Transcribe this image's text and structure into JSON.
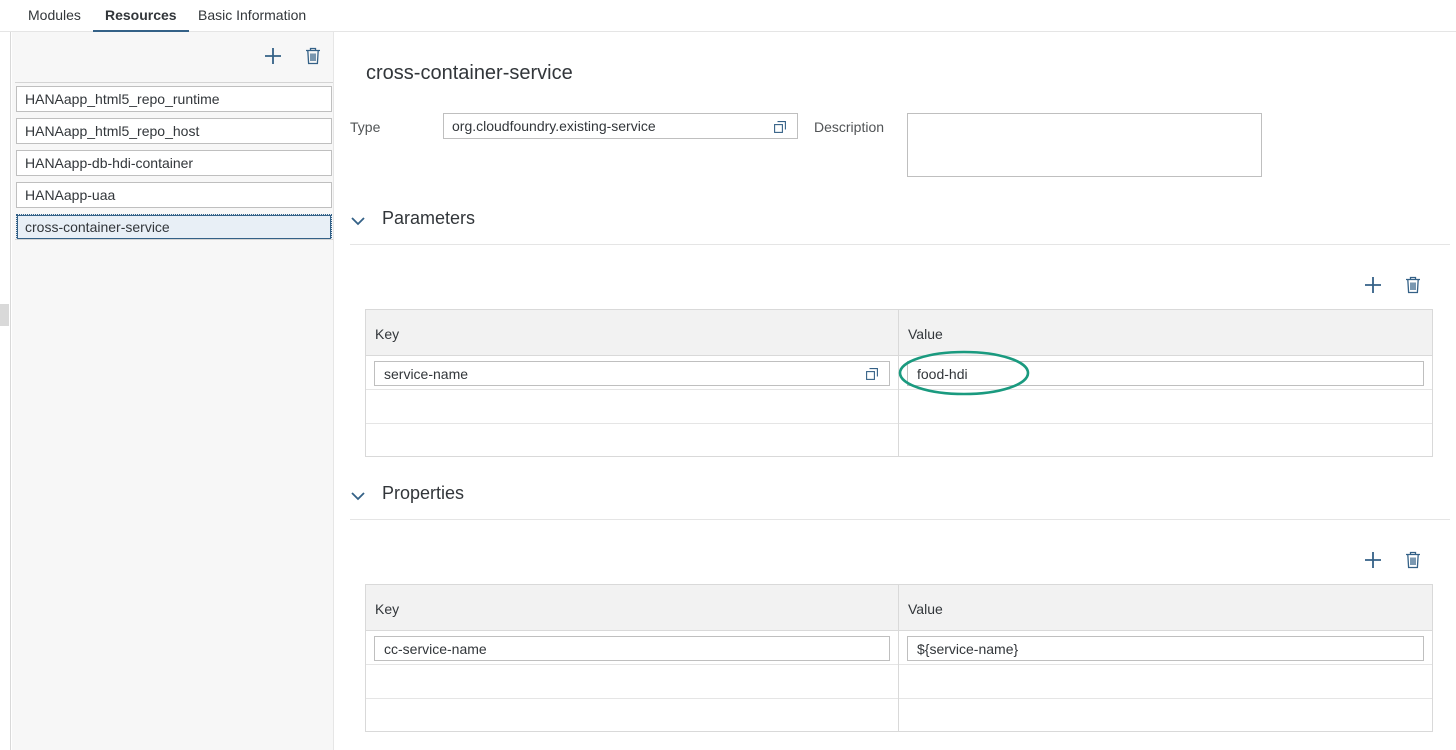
{
  "tabs": [
    {
      "label": "Modules",
      "active": false
    },
    {
      "label": "Resources",
      "active": true
    },
    {
      "label": "Basic Information",
      "active": false
    }
  ],
  "resources": {
    "items": [
      {
        "label": "HANAapp_html5_repo_runtime",
        "selected": false
      },
      {
        "label": "HANAapp_html5_repo_host",
        "selected": false
      },
      {
        "label": "HANAapp-db-hdi-container",
        "selected": false
      },
      {
        "label": "HANAapp-uaa",
        "selected": false
      },
      {
        "label": "cross-container-service",
        "selected": true
      }
    ]
  },
  "detail": {
    "title": "cross-container-service",
    "type_label": "Type",
    "type_value": "org.cloudfoundry.existing-service",
    "description_label": "Description",
    "description_value": ""
  },
  "parameters": {
    "title": "Parameters",
    "headers": {
      "key": "Key",
      "value": "Value"
    },
    "rows": [
      {
        "key": "service-name",
        "value": "food-hdi"
      }
    ]
  },
  "properties": {
    "title": "Properties",
    "headers": {
      "key": "Key",
      "value": "Value"
    },
    "rows": [
      {
        "key": "cc-service-name",
        "value": "${service-name}"
      }
    ]
  },
  "colors": {
    "accent": "#346187",
    "highlight_ring": "#1a9a7f"
  },
  "icons": {
    "add": "add-icon",
    "delete": "delete-icon",
    "value_help": "value-help-icon",
    "collapse": "chevron-down-icon"
  }
}
